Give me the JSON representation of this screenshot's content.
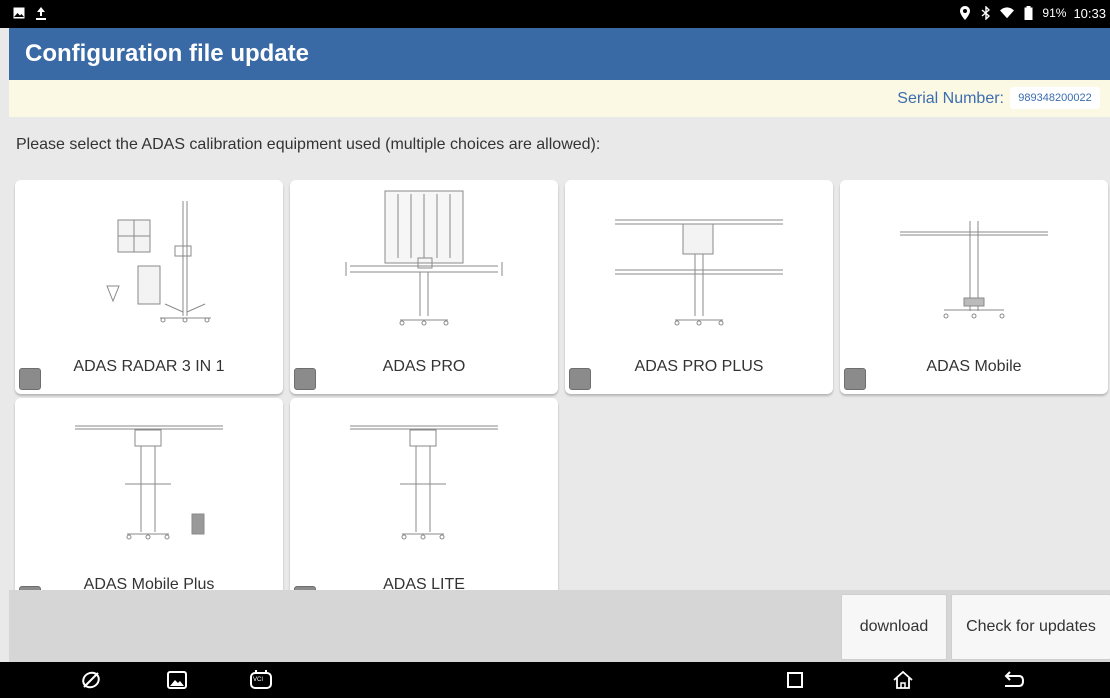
{
  "status_bar": {
    "battery": "91%",
    "time": "10:33",
    "left_icons": [
      "image-icon",
      "upload-icon"
    ],
    "right_icons": [
      "location-icon",
      "bluetooth-icon",
      "wifi-icon",
      "battery-icon"
    ]
  },
  "header": {
    "title": "Configuration file update",
    "background": "#3a6aa6"
  },
  "serial": {
    "label": "Serial Number:",
    "value": "989348200022"
  },
  "instruction": "Please select the ADAS calibration equipment used (multiple choices are allowed):",
  "equipment": [
    {
      "label": "ADAS RADAR 3 IN 1",
      "selected": false
    },
    {
      "label": "ADAS PRO",
      "selected": false
    },
    {
      "label": "ADAS PRO PLUS",
      "selected": false
    },
    {
      "label": "ADAS Mobile",
      "selected": false
    },
    {
      "label": "ADAS Mobile Plus",
      "selected": false
    },
    {
      "label": "ADAS LITE",
      "selected": false
    }
  ],
  "actions": {
    "download": "download",
    "check_updates": "Check for updates"
  },
  "nav_bar": {
    "icons": [
      "browser-icon",
      "gallery-icon",
      "vci-icon",
      "recents-icon",
      "home-icon",
      "back-icon"
    ],
    "vci_text": "VCI"
  }
}
